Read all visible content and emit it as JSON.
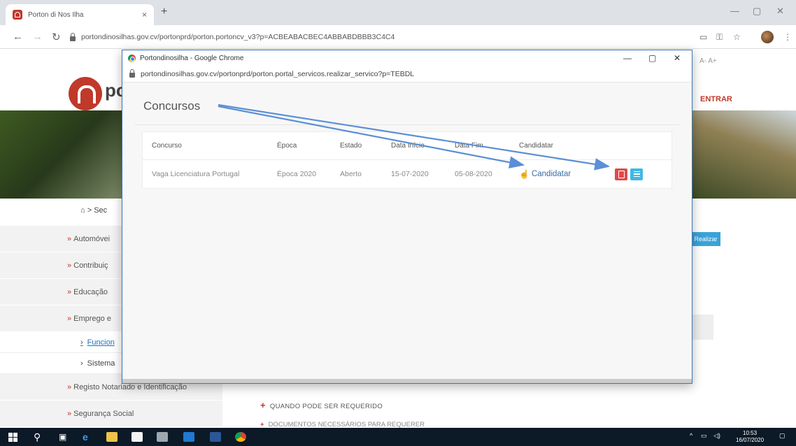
{
  "browser": {
    "tab_title": "Porton di Nos Ilha",
    "tab_close": "×",
    "new_tab": "+",
    "url": "portondinosilhas.gov.cv/portonprd/porton.portoncv_v3?p=ACBEABACBEC4ABBABDBBB3C4C4",
    "window_min": "—",
    "window_max": "▢",
    "window_close": "✕"
  },
  "page": {
    "logo_text": "po",
    "font_size_controls": "A-  A+",
    "login_label": "ENTRAR",
    "breadcrumb": "> Sec",
    "realizar_button": "Realizar",
    "sidebar": [
      {
        "label": "Automóvei"
      },
      {
        "label": "Contribuiç"
      },
      {
        "label": "Educação"
      },
      {
        "label": "Emprego e"
      }
    ],
    "sidebar_sub": [
      {
        "label": "Funcion"
      },
      {
        "label": "Sistema"
      }
    ],
    "sidebar_more": [
      {
        "label": "Registo Notariado e Identificação"
      },
      {
        "label": "Segurança Social"
      }
    ],
    "quando_pode": "QUANDO PODE SER REQUERIDO",
    "documentos": "DOCUMENTOS NECESSÁRIOS PARA REQUERER"
  },
  "popup": {
    "window_title": "Portondinosilha - Google Chrome",
    "url": "portondinosilhas.gov.cv/portonprd/porton.portal_servicos.realizar_servico?p=TEBDL",
    "heading": "Concursos",
    "table": {
      "headers": [
        "Concurso",
        "Época",
        "Estado",
        "Data Início",
        "Data Fim",
        "Candidatar"
      ],
      "rows": [
        {
          "concurso": "Vaga Licenciatura Portugal",
          "epoca": "Época 2020",
          "estado": "Aberto",
          "data_inicio": "15-07-2020",
          "data_fim": "05-08-2020",
          "candidatar": "Candidatar"
        }
      ]
    }
  },
  "taskbar": {
    "time": "10:53",
    "date": "16/07/2020"
  },
  "colors": {
    "brand_red": "#c0392b",
    "link_blue": "#3a6ea5",
    "pdf_red": "#e0494b",
    "list_cyan": "#3fb9e4",
    "arrow_blue": "#5b8fd6"
  }
}
